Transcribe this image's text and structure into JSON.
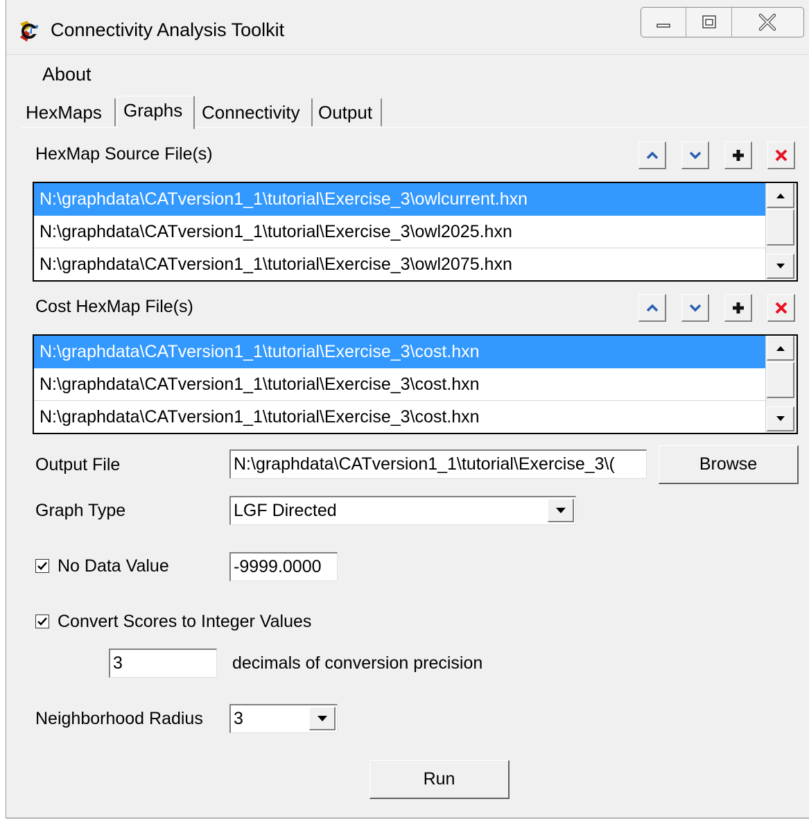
{
  "window": {
    "title": "Connectivity Analysis Toolkit"
  },
  "menu": {
    "items": [
      "About"
    ]
  },
  "tabs": [
    "HexMaps",
    "Graphs",
    "Connectivity",
    "Output"
  ],
  "active_tab": "Graphs",
  "source_files": {
    "label": "HexMap Source File(s)",
    "items": [
      "N:\\graphdata\\CATversion1_1\\tutorial\\Exercise_3\\owlcurrent.hxn",
      "N:\\graphdata\\CATversion1_1\\tutorial\\Exercise_3\\owl2025.hxn",
      "N:\\graphdata\\CATversion1_1\\tutorial\\Exercise_3\\owl2075.hxn"
    ]
  },
  "cost_files": {
    "label": "Cost HexMap File(s)",
    "items": [
      "N:\\graphdata\\CATversion1_1\\tutorial\\Exercise_3\\cost.hxn",
      "N:\\graphdata\\CATversion1_1\\tutorial\\Exercise_3\\cost.hxn",
      "N:\\graphdata\\CATversion1_1\\tutorial\\Exercise_3\\cost.hxn"
    ]
  },
  "output_file": {
    "label": "Output File",
    "value": "N:\\graphdata\\CATversion1_1\\tutorial\\Exercise_3\\(",
    "browse_label": "Browse"
  },
  "graph_type": {
    "label": "Graph Type",
    "value": "LGF Directed"
  },
  "no_data": {
    "label": "No Data Value",
    "checked": true,
    "value": "-9999.0000"
  },
  "convert": {
    "label": "Convert Scores to Integer Values",
    "checked": true,
    "precision": "3",
    "precision_label": "decimals of conversion precision"
  },
  "radius": {
    "label": "Neighborhood Radius",
    "value": "3"
  },
  "run_label": "Run",
  "colors": {
    "selection": "#3399ff",
    "close_red": "#e81123",
    "tool_blue": "#2a5fb0"
  }
}
